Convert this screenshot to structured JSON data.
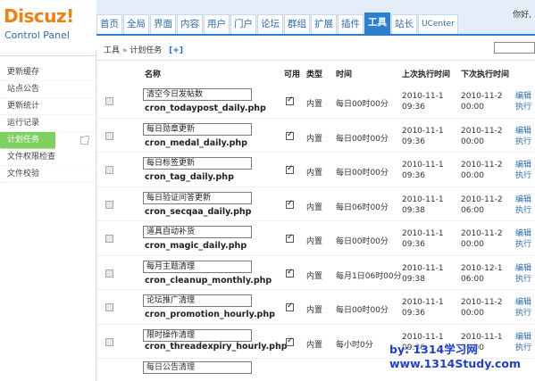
{
  "logo": {
    "title": "Discuz!",
    "subtitle": "Control Panel"
  },
  "header": {
    "greeting": "你好,",
    "tabs": [
      {
        "label": "首页",
        "active": false
      },
      {
        "label": "全局",
        "active": false
      },
      {
        "label": "界面",
        "active": false
      },
      {
        "label": "内容",
        "active": false
      },
      {
        "label": "用户",
        "active": false
      },
      {
        "label": "门户",
        "active": false
      },
      {
        "label": "论坛",
        "active": false
      },
      {
        "label": "群组",
        "active": false
      },
      {
        "label": "扩展",
        "active": false
      },
      {
        "label": "插件",
        "active": false
      },
      {
        "label": "工具",
        "active": true
      },
      {
        "label": "站长",
        "active": false
      },
      {
        "label": "UCenter",
        "active": false
      }
    ]
  },
  "sidebar": {
    "items": [
      {
        "label": "更新缓存",
        "active": false
      },
      {
        "label": "站点公告",
        "active": false
      },
      {
        "label": "更新统计",
        "active": false
      },
      {
        "label": "运行记录",
        "active": false
      },
      {
        "label": "计划任务",
        "active": true
      },
      {
        "label": "文件权限检查",
        "active": false
      },
      {
        "label": "文件校验",
        "active": false
      }
    ],
    "external_icon": "new-window-icon"
  },
  "breadcrumb": {
    "section": "工具",
    "separator": "»",
    "page": "计划任务",
    "add_label": "[+]"
  },
  "table": {
    "headers": {
      "name": "名称",
      "enabled": "可用",
      "type": "类型",
      "time": "时间",
      "last_run": "上次执行时间",
      "next_run": "下次执行时间"
    },
    "edit_label": "编辑",
    "run_label": "执行",
    "rows": [
      {
        "name": "清空今日发帖数",
        "script": "cron_todaypost_daily.php",
        "enabled": true,
        "type": "内置",
        "time": "每日00时00分",
        "last": "2010-11-1\n09:36",
        "next": "2010-11-2\n00:00"
      },
      {
        "name": "每日勋章更新",
        "script": "cron_medal_daily.php",
        "enabled": true,
        "type": "内置",
        "time": "每日00时00分",
        "last": "2010-11-1\n09:36",
        "next": "2010-11-2\n00:00"
      },
      {
        "name": "每日标签更新",
        "script": "cron_tag_daily.php",
        "enabled": true,
        "type": "内置",
        "time": "每日00时00分",
        "last": "2010-11-1\n09:36",
        "next": "2010-11-2\n00:00"
      },
      {
        "name": "每日验证问答更新",
        "script": "cron_secqaa_daily.php",
        "enabled": true,
        "type": "内置",
        "time": "每日06时00分",
        "last": "2010-11-1\n09:38",
        "next": "2010-11-2\n06:00"
      },
      {
        "name": "道具自动补货",
        "script": "cron_magic_daily.php",
        "enabled": true,
        "type": "内置",
        "time": "每日00时00分",
        "last": "2010-11-1\n09:36",
        "next": "2010-11-2\n00:00"
      },
      {
        "name": "每月主题清理",
        "script": "cron_cleanup_monthly.php",
        "enabled": true,
        "type": "内置",
        "time": "每月1日06时00分",
        "last": "2010-11-1\n09:38",
        "next": "2010-12-1\n06:00"
      },
      {
        "name": "论坛推广清理",
        "script": "cron_promotion_hourly.php",
        "enabled": true,
        "type": "内置",
        "time": "每日00时00分",
        "last": "2010-11-1\n09:36",
        "next": "2010-11-2\n00:00"
      },
      {
        "name": "限时操作清理",
        "script": "cron_threadexpiry_hourly.php",
        "enabled": true,
        "type": "内置",
        "time": "每小时0分",
        "last": "2010-11-1\n09:36",
        "next": "2010-11-1\n10:00"
      }
    ],
    "partial_row_name": "每日公告清理"
  },
  "watermark": {
    "line1": "by: 1314学习网",
    "line2": "www.1314Study.com"
  }
}
